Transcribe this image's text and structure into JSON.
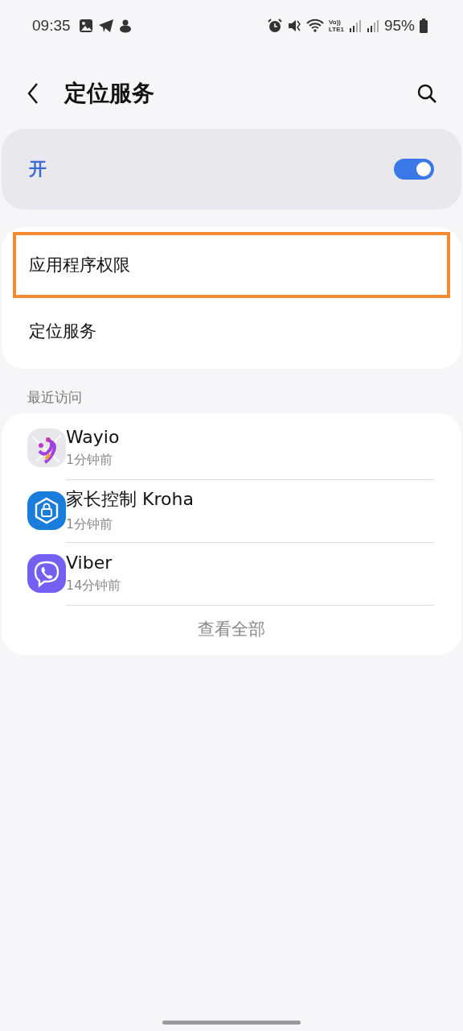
{
  "status_bar": {
    "time": "09:35",
    "volte": [
      "Vo))",
      "LTE1"
    ],
    "battery": "95%"
  },
  "header": {
    "title": "定位服务"
  },
  "master_switch": {
    "label": "开",
    "on": true
  },
  "menu": [
    {
      "label": "应用程序权限",
      "highlighted": true
    },
    {
      "label": "定位服务",
      "highlighted": false
    }
  ],
  "recent": {
    "heading": "最近访问",
    "apps": [
      {
        "name": "Wayio",
        "time": "1分钟前",
        "kind": "wayio"
      },
      {
        "name": "家长控制 Kroha",
        "time": "1分钟前",
        "kind": "shield"
      },
      {
        "name": "Viber",
        "time": "14分钟前",
        "kind": "viber"
      }
    ],
    "view_all": "查看全部"
  }
}
